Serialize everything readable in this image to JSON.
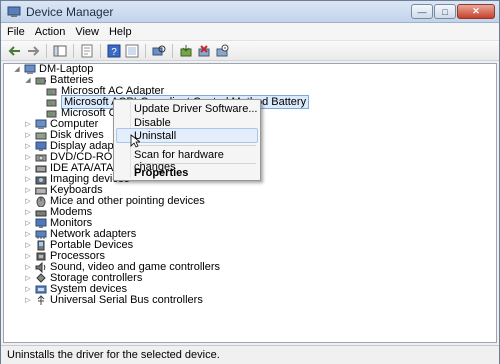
{
  "window": {
    "title": "Device Manager"
  },
  "menu": {
    "file": "File",
    "action": "Action",
    "view": "View",
    "help": "Help"
  },
  "tree": {
    "root": "DM-Laptop",
    "batteries": "Batteries",
    "battery_children": [
      "Microsoft AC Adapter",
      "Microsoft ACPI-Compliant Control Method Battery",
      "Microsoft Comp"
    ],
    "categories": [
      "Computer",
      "Disk drives",
      "Display adapters",
      "DVD/CD-ROM drive",
      "IDE ATA/ATAPI con",
      "Imaging devices",
      "Keyboards",
      "Mice and other pointing devices",
      "Modems",
      "Monitors",
      "Network adapters",
      "Portable Devices",
      "Processors",
      "Sound, video and game controllers",
      "Storage controllers",
      "System devices",
      "Universal Serial Bus controllers"
    ]
  },
  "context_menu": {
    "update_driver": "Update Driver Software...",
    "disable": "Disable",
    "uninstall": "Uninstall",
    "scan": "Scan for hardware changes",
    "properties": "Properties"
  },
  "status": {
    "text": "Uninstalls the driver for the selected device."
  }
}
